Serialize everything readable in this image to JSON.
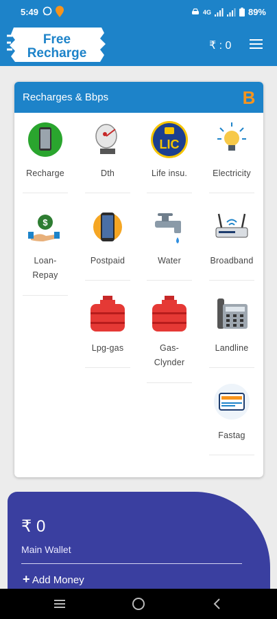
{
  "status": {
    "time": "5:49",
    "network": "4G",
    "battery": "89%"
  },
  "appbar": {
    "logo_line1": "Free",
    "logo_line2": "Recharge",
    "balance": "₹ : 0"
  },
  "card": {
    "title": "Recharges & Bbps",
    "brand_letter": "B",
    "items": [
      {
        "label": "Recharge",
        "icon": "mobile-icon"
      },
      {
        "label": "Dth",
        "icon": "dish-antenna-icon"
      },
      {
        "label": "Life insu.",
        "icon": "lic-icon"
      },
      {
        "label": "Electricity",
        "icon": "bulb-icon"
      },
      {
        "label": "Loan-",
        "label2": "Repay",
        "icon": "loan-icon"
      },
      {
        "label": "Postpaid",
        "icon": "postpaid-phone-icon"
      },
      {
        "label": "Water",
        "icon": "tap-icon"
      },
      {
        "label": "Broadband",
        "icon": "router-icon"
      },
      {
        "label": "Lpg-gas",
        "icon": "gas-cylinder-icon"
      },
      {
        "label": "Gas-",
        "label2": "Clynder",
        "icon": "gas-cylinder-icon"
      },
      {
        "label": "Landline",
        "icon": "landline-phone-icon"
      },
      {
        "label": "Fastag",
        "icon": "fastag-icon"
      }
    ]
  },
  "wallet": {
    "amount": "₹ 0",
    "label": "Main Wallet",
    "add_money": "Add Money"
  },
  "colors": {
    "primary": "#1d83c9",
    "wallet": "#3a3fa0",
    "accent": "#f7941d"
  }
}
